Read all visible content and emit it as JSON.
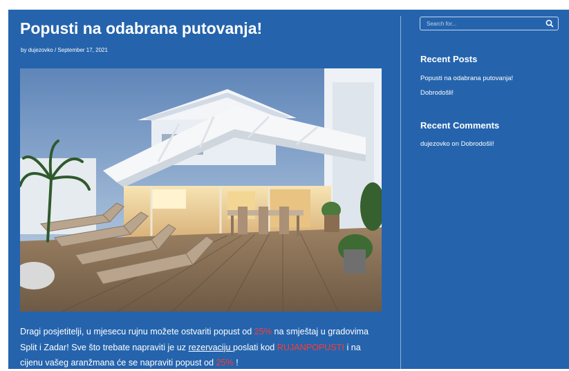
{
  "post": {
    "title": "Popusti na odabrana putovanja!",
    "meta_by": "by",
    "author": "dujezovko",
    "meta_separator": "/",
    "date": "September 17, 2021",
    "image_alt": "Terasa vile s ležaljkama",
    "body": {
      "part1": "Dragi posjetitelji, u mjesecu rujnu možete ostvariti popust od ",
      "discount1": "25%",
      "part2": " na smještaj u gradovima Split i Zadar! Sve što trebate napraviti je uz ",
      "link_text": "rezervaciju ",
      "part3": "poslati kod ",
      "code": "RUJANPOPUSTI",
      "part4": " i na cijenu vašeg aranžmana će se napraviti popust od ",
      "discount2": "25%",
      "part5": " !"
    }
  },
  "sidebar": {
    "search": {
      "placeholder": "Search for...",
      "icon": "search-icon"
    },
    "recent_posts": {
      "title": "Recent Posts",
      "items": [
        "Popusti na odabrana putovanja!",
        "Dobrodošli!"
      ]
    },
    "recent_comments": {
      "title": "Recent Comments",
      "author": "dujezovko",
      "connector": " on ",
      "post": "Dobrodošli!"
    }
  },
  "colors": {
    "background": "#2564ad",
    "highlight": "#ff3b30",
    "text": "#ffffff"
  }
}
